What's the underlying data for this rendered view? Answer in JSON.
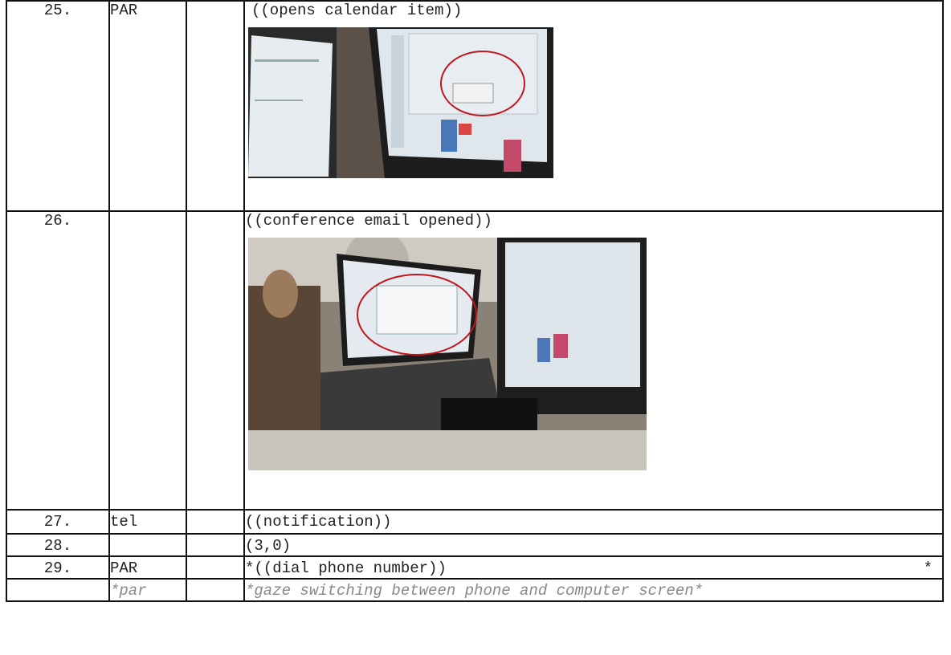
{
  "rows": [
    {
      "num": "25.",
      "speaker": "PAR",
      "text": "((opens calendar item))",
      "still": "photo"
    },
    {
      "num": "26.",
      "speaker": "",
      "text": "((conference email opened))",
      "still": "photo"
    },
    {
      "num": "27.",
      "speaker": "tel",
      "text": "((notification))"
    },
    {
      "num": "28.",
      "speaker": "",
      "text": "(3,0)"
    },
    {
      "num": "29.",
      "speaker": "PAR",
      "text": "*((dial phone number))",
      "tail": "*"
    },
    {
      "num": "",
      "speaker": "*par",
      "text": "*gaze switching between phone and computer screen*"
    }
  ]
}
